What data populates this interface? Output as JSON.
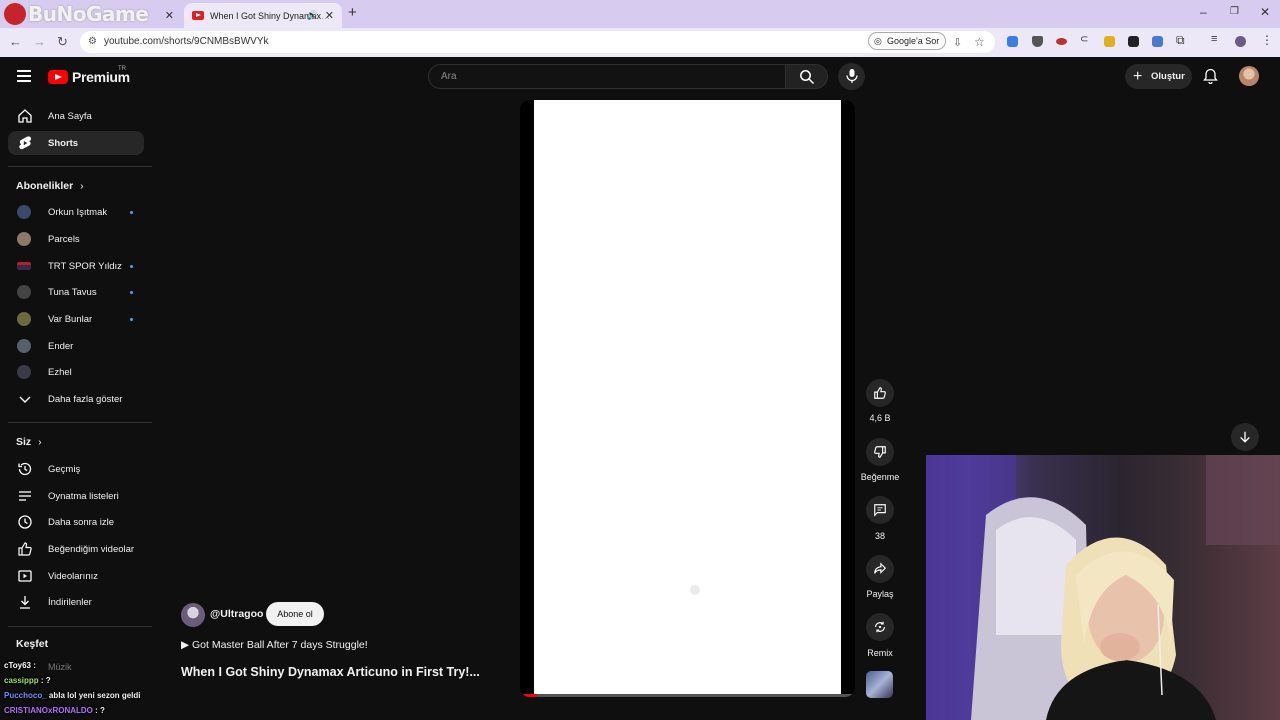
{
  "browser": {
    "watermark": "BuNoGame",
    "tabs": [
      {
        "label": ""
      },
      {
        "label": "When I Got Shiny Dynamax",
        "active": true
      }
    ],
    "url": "youtube.com/shorts/9CNMBsBWVYk",
    "google_lens_label": "Google'a Sor"
  },
  "youtube": {
    "logo_text": "Premium",
    "region": "TR",
    "search_placeholder": "Ara",
    "create_label": "Oluştur"
  },
  "sidebar": {
    "main": [
      {
        "label": "Ana Sayfa",
        "icon": "home-icon"
      },
      {
        "label": "Shorts",
        "icon": "shorts-icon",
        "active": true
      }
    ],
    "subscriptions_header": "Abonelikler",
    "subscriptions": [
      {
        "label": "Orkun Işıtmak",
        "dot": true,
        "color": "#3b4a6a"
      },
      {
        "label": "Parcels",
        "dot": false,
        "color": "#8a7a66"
      },
      {
        "label": "TRT SPOR Yıldız",
        "dot": true,
        "color": "#b02030"
      },
      {
        "label": "Tuna Tavus",
        "dot": true,
        "color": "#444444"
      },
      {
        "label": "Var Bunlar",
        "dot": true,
        "color": "#6a6a3a"
      },
      {
        "label": "Ender",
        "dot": false,
        "color": "#56606a"
      },
      {
        "label": "Ezhel",
        "dot": false,
        "color": "#3a3a4a"
      }
    ],
    "show_more": "Daha fazla göster",
    "you_header": "Siz",
    "you_items": [
      {
        "label": "Geçmiş",
        "icon": "history-icon"
      },
      {
        "label": "Oynatma listeleri",
        "icon": "playlist-icon"
      },
      {
        "label": "Daha sonra izle",
        "icon": "clock-icon"
      },
      {
        "label": "Beğendiğim videolar",
        "icon": "like-icon"
      },
      {
        "label": "Videolarınız",
        "icon": "video-icon"
      },
      {
        "label": "İndirilenler",
        "icon": "download-icon"
      }
    ],
    "explore_header": "Keşfet",
    "explore_partial": "Müzik"
  },
  "short": {
    "channel": "@Ultragoo",
    "subscribe_label": "Abone ol",
    "music_line": "▶ Got Master Ball After 7 days Struggle!",
    "title": "When I Got Shiny Dynamax Articuno in First Try!...",
    "progress": 0.05,
    "actions": {
      "likes": "4,6 B",
      "dislike": "Beğenme",
      "comments": "38",
      "share": "Paylaş",
      "remix": "Remix"
    }
  },
  "chat": [
    {
      "user": "cToy63",
      "msg": ":",
      "color": "#ffffff"
    },
    {
      "user": "cassippp",
      "msg": ": ?",
      "color": "#9be15d"
    },
    {
      "user": "Pucchoco_",
      "msg": "abla lol yeni sezon geldi",
      "color": "#6f8cff"
    },
    {
      "user": "CRISTIANOxRONALDO",
      "msg": ": ?",
      "color": "#b56cff"
    }
  ]
}
